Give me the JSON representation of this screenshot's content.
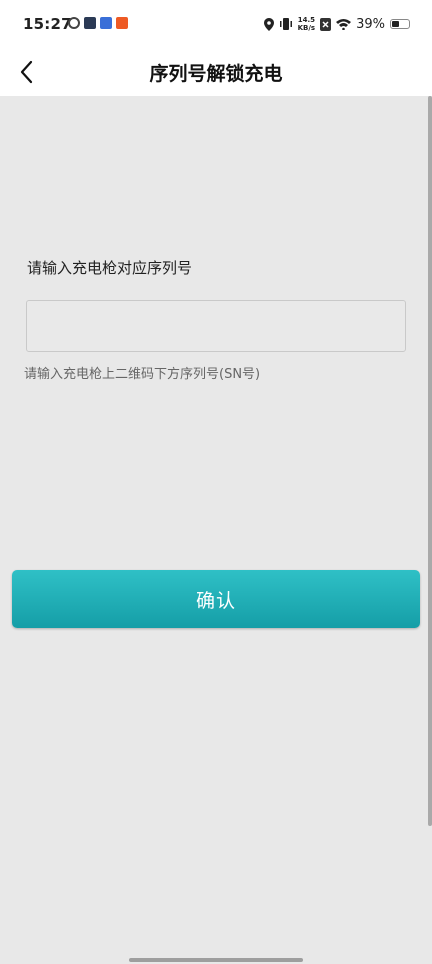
{
  "status_bar": {
    "time": "15:27",
    "net_speed_value": "14.5",
    "net_speed_unit": "KB/s",
    "battery_percent": "39%",
    "battery_level": 0.39,
    "left_icons": [
      "sync-icon",
      "media-icon",
      "game-icon",
      "app-badge-icon"
    ],
    "app_icon_colors": [
      "#444444",
      "#2b3a55",
      "#3a6fd8",
      "#ee5a24"
    ]
  },
  "header": {
    "title": "序列号解锁充电",
    "back_icon": "chevron-left-icon"
  },
  "form": {
    "label": "请输入充电枪对应序列号",
    "input_value": "",
    "hint": "请输入充电枪上二维码下方序列号(SN号)"
  },
  "actions": {
    "confirm_label": "确认",
    "confirm_color": "#1fb0b8"
  }
}
